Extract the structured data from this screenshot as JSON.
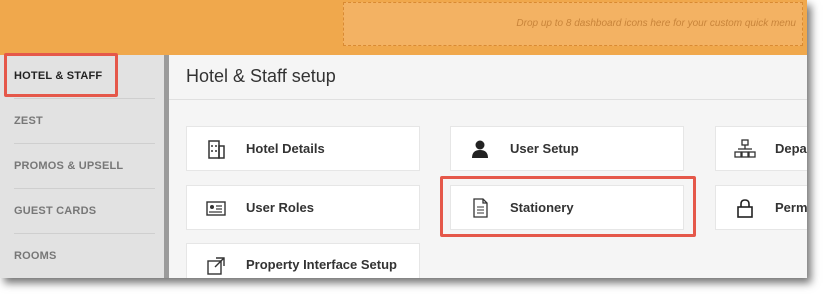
{
  "topbar": {
    "dropzone_text": "Drop up to 8 dashboard icons here for your custom quick menu"
  },
  "sidebar": {
    "items": [
      {
        "label": "HOTEL & STAFF"
      },
      {
        "label": "ZEST"
      },
      {
        "label": "PROMOS & UPSELL"
      },
      {
        "label": "GUEST CARDS"
      },
      {
        "label": "ROOMS"
      }
    ]
  },
  "main": {
    "title": "Hotel & Staff setup",
    "cards": [
      {
        "label": "Hotel Details",
        "icon": "building-icon"
      },
      {
        "label": "User Setup",
        "icon": "user-icon"
      },
      {
        "label": "Depa",
        "icon": "org-chart-icon"
      },
      {
        "label": "User Roles",
        "icon": "id-card-icon"
      },
      {
        "label": "Stationery",
        "icon": "document-icon"
      },
      {
        "label": "Perm",
        "icon": "lock-icon"
      },
      {
        "label": "Property Interface Setup",
        "icon": "external-link-icon"
      }
    ]
  },
  "colors": {
    "topbar": "#f0a84c",
    "highlight": "#e5584a",
    "sidebar": "#e2e2e2"
  }
}
